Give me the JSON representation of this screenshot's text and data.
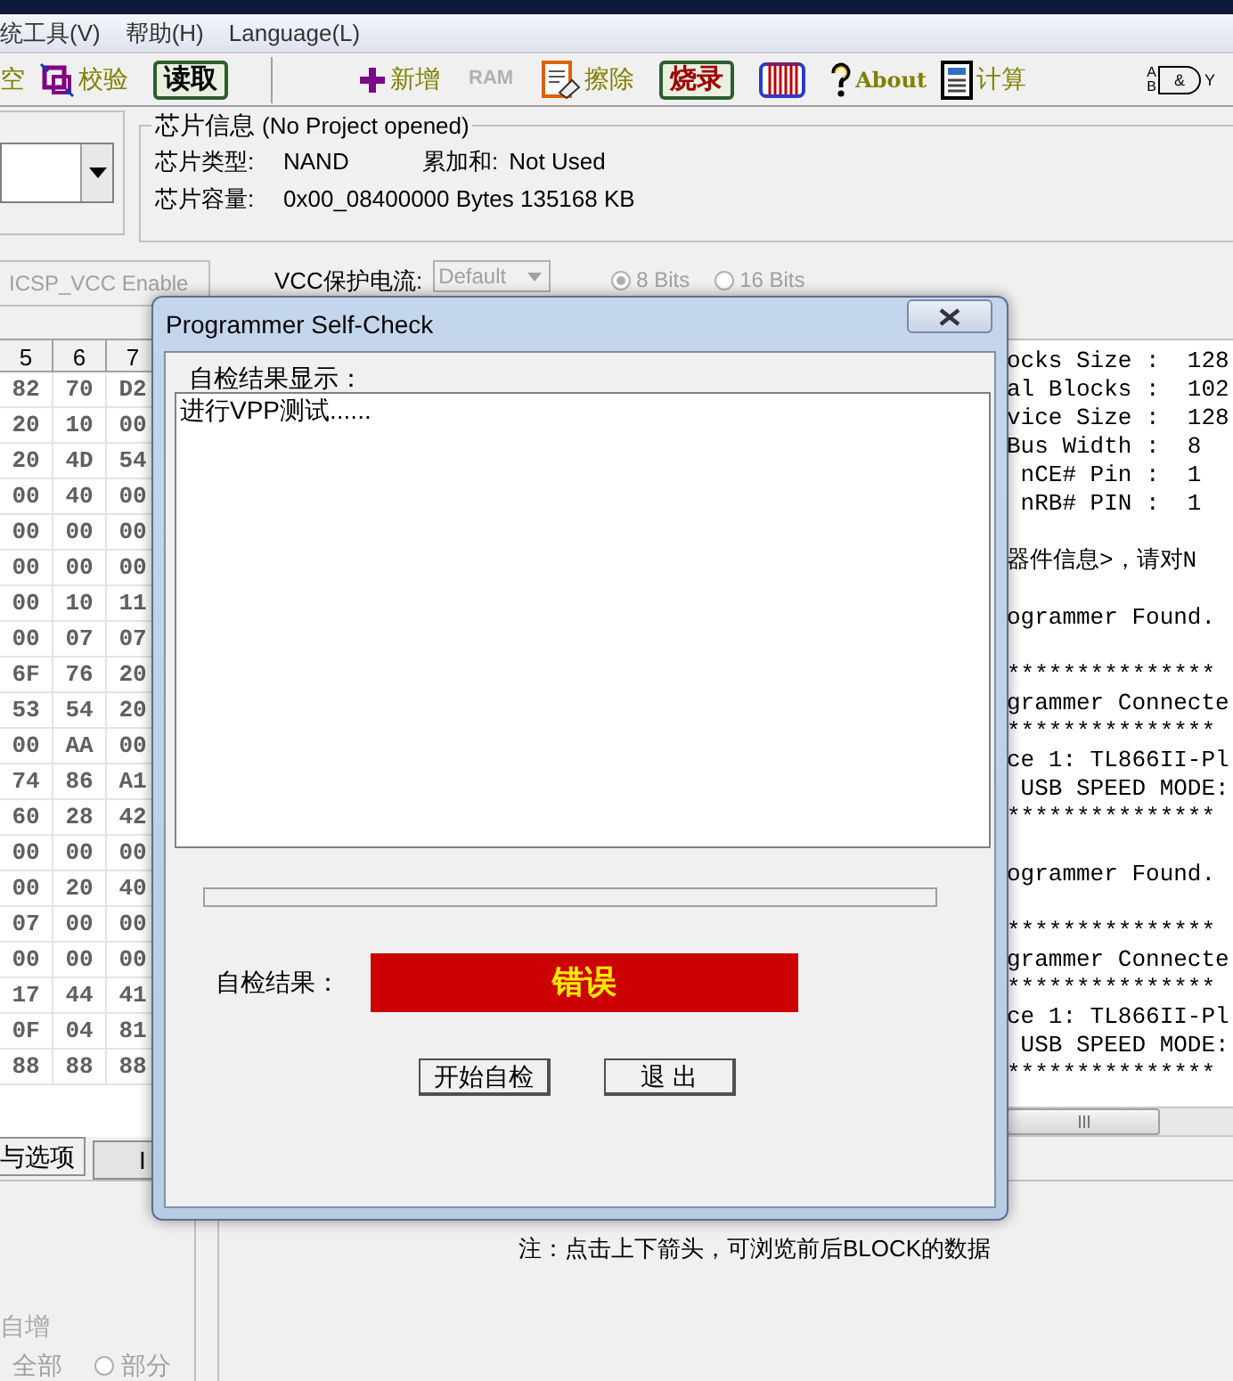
{
  "menu": [
    {
      "label": "统工具(V)"
    },
    {
      "label": "帮助(H)"
    },
    {
      "label": "Language(L)"
    }
  ],
  "toolbar": [
    {
      "kind": "text",
      "label": "空"
    },
    {
      "kind": "verify",
      "label": "校验"
    },
    {
      "kind": "framed",
      "label": "读取"
    },
    {
      "kind": "separator"
    },
    {
      "kind": "plus",
      "label": "新增"
    },
    {
      "kind": "ram",
      "label": "RAM",
      "disabled": true
    },
    {
      "kind": "erase",
      "label": "擦除"
    },
    {
      "kind": "framedred",
      "label": "烧录"
    },
    {
      "kind": "chip"
    },
    {
      "kind": "help",
      "label": "About"
    },
    {
      "kind": "calc",
      "label": "计算"
    },
    {
      "kind": "gate",
      "labels": [
        "A",
        "B",
        "&",
        "Y"
      ]
    }
  ],
  "chip_info": {
    "title": "芯片信息",
    "subtitle": "(No Project opened)",
    "fields": [
      {
        "label": "芯片类型:",
        "value": "NAND"
      },
      {
        "label": "累加和:",
        "value": "Not Used"
      },
      {
        "label": "芯片容量:",
        "value": "0x00_08400000 Bytes 135168 KB"
      }
    ]
  },
  "options_row": {
    "icsp": {
      "label": "ICSP_VCC Enable",
      "disabled": true
    },
    "vcc_label": "VCC保护电流:",
    "vcc_select": {
      "value": "Default",
      "disabled": true
    },
    "bits": [
      {
        "label": "8 Bits",
        "selected": true
      },
      {
        "label": "16 Bits",
        "selected": false
      }
    ]
  },
  "hex_table": {
    "columns": [
      "5",
      "6",
      "7"
    ],
    "rows": [
      [
        "82",
        "70",
        "D2"
      ],
      [
        "20",
        "10",
        "00"
      ],
      [
        "20",
        "4D",
        "54"
      ],
      [
        "00",
        "40",
        "00"
      ],
      [
        "00",
        "00",
        "00"
      ],
      [
        "00",
        "00",
        "00"
      ],
      [
        "00",
        "10",
        "11"
      ],
      [
        "00",
        "07",
        "07"
      ],
      [
        "6F",
        "76",
        "20"
      ],
      [
        "53",
        "54",
        "20"
      ],
      [
        "00",
        "AA",
        "00"
      ],
      [
        "74",
        "86",
        "A1"
      ],
      [
        "60",
        "28",
        "42"
      ],
      [
        "00",
        "00",
        "00"
      ],
      [
        "00",
        "20",
        "40"
      ],
      [
        "07",
        "00",
        "00"
      ],
      [
        "00",
        "00",
        "00"
      ],
      [
        "17",
        "44",
        "41"
      ],
      [
        "0F",
        "04",
        "81"
      ],
      [
        "88",
        "88",
        "88"
      ]
    ]
  },
  "log": {
    "blocks": [
      [
        "ocks Size :  128",
        "al Blocks :  102",
        "vice Size :  128",
        "Bus Width :  8",
        " nCE# Pin :  1",
        " nRB# PIN :  1"
      ],
      [
        "器件信息>，请对N"
      ],
      [
        "ogrammer Found."
      ],
      [
        "***************",
        "grammer Connecte",
        "***************",
        "ce 1: TL866II-Pl",
        " USB SPEED MODE:",
        "***************"
      ],
      [
        "ogrammer Found."
      ],
      [
        "***************",
        "grammer Connecte",
        "***************",
        "ce 1: TL866II-Pl",
        " USB SPEED MODE:",
        "***************"
      ]
    ]
  },
  "tabs": [
    {
      "label": "与选项",
      "selected": true
    },
    {
      "label": "I",
      "selected": false
    }
  ],
  "bottom": {
    "increment": {
      "label": "自增",
      "disabled": true
    },
    "all_label": "全部",
    "part_option": {
      "label": "部分",
      "selected": false
    },
    "note": "注：点击上下箭头，可浏览前后BLOCK的数据"
  },
  "dialog": {
    "title": "Programmer Self-Check",
    "output_label": "自检结果显示：",
    "output_text": "进行VPP测试......",
    "progress": {
      "level": 0
    },
    "result_label": "自检结果：",
    "result": {
      "value": "错误"
    },
    "buttons": [
      "开始自检",
      "退 出"
    ]
  }
}
